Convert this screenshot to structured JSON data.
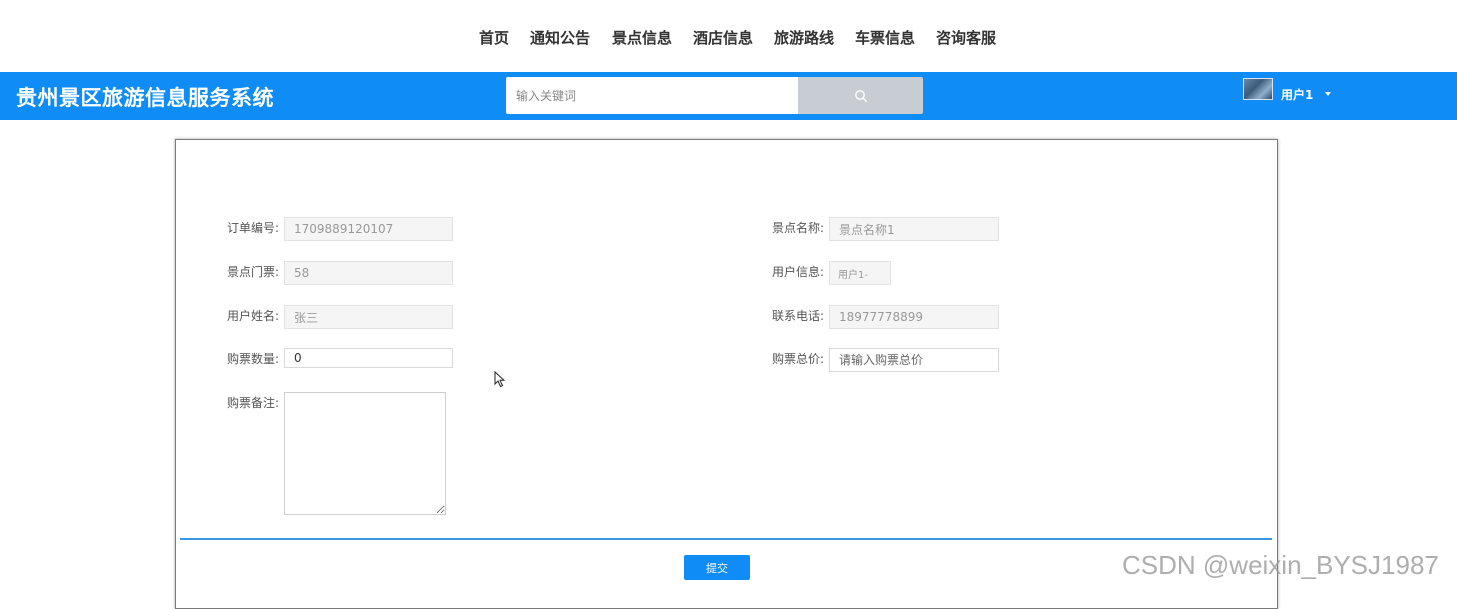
{
  "nav": {
    "items": [
      "首页",
      "通知公告",
      "景点信息",
      "酒店信息",
      "旅游路线",
      "车票信息",
      "咨询客服"
    ]
  },
  "header": {
    "title": "贵州景区旅游信息服务系统",
    "search_placeholder": "输入关键词",
    "search_icon": "search-icon",
    "user_name": "用户1",
    "accent_color": "#0f8cf5"
  },
  "form": {
    "order_no": {
      "label": "订单编号:",
      "value": "1709889120107"
    },
    "scenic_name": {
      "label": "景点名称:",
      "value": "景点名称1"
    },
    "ticket_price": {
      "label": "景点门票:",
      "value": "58"
    },
    "user_info": {
      "label": "用户信息:",
      "value": "用户1-"
    },
    "user_fullname": {
      "label": "用户姓名:",
      "value": "张三"
    },
    "phone": {
      "label": "联系电话:",
      "value": "18977778899"
    },
    "quantity": {
      "label": "购票数量:",
      "value": "0"
    },
    "total_price": {
      "label": "购票总价:",
      "placeholder": "请输入购票总价"
    },
    "remark": {
      "label": "购票备注:",
      "value": ""
    },
    "submit_label": "提交"
  },
  "watermark": "CSDN @weixin_BYSJ1987"
}
